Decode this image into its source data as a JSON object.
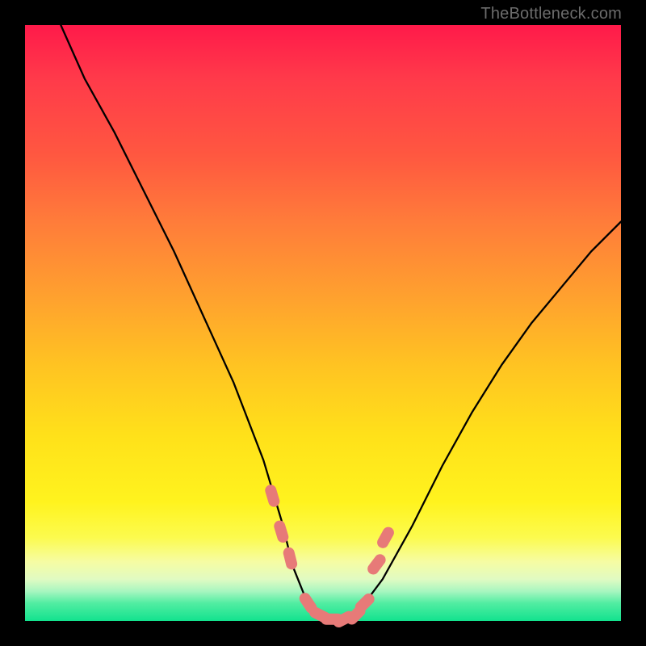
{
  "attribution": "TheBottleneck.com",
  "colors": {
    "frame": "#000000",
    "curve": "#000000",
    "lobes": "#e77a78",
    "attribution_text": "#6c6c6c"
  },
  "gradient_stops": [
    {
      "pct": 0,
      "color": "#ff1a4a"
    },
    {
      "pct": 9,
      "color": "#ff3a4a"
    },
    {
      "pct": 22,
      "color": "#ff5840"
    },
    {
      "pct": 33,
      "color": "#ff7c3a"
    },
    {
      "pct": 46,
      "color": "#ffa22e"
    },
    {
      "pct": 57,
      "color": "#ffc322"
    },
    {
      "pct": 69,
      "color": "#ffe11a"
    },
    {
      "pct": 80,
      "color": "#fff31e"
    },
    {
      "pct": 86,
      "color": "#fcfb4e"
    },
    {
      "pct": 90,
      "color": "#f6fca2"
    },
    {
      "pct": 93,
      "color": "#e0fbc2"
    },
    {
      "pct": 95,
      "color": "#a8f6c0"
    },
    {
      "pct": 97,
      "color": "#52eda2"
    },
    {
      "pct": 100,
      "color": "#12e28e"
    }
  ],
  "chart_data": {
    "type": "line",
    "title": "",
    "xlabel": "",
    "ylabel": "",
    "xlim": [
      0,
      100
    ],
    "ylim": [
      0,
      100
    ],
    "grid": false,
    "legend": false,
    "x": [
      6,
      10,
      15,
      20,
      25,
      30,
      35,
      40,
      43,
      45,
      47,
      49,
      51,
      53,
      55,
      57,
      60,
      65,
      70,
      75,
      80,
      85,
      90,
      95,
      100
    ],
    "series": [
      {
        "name": "bottleneck-curve",
        "values": [
          100,
          91,
          82,
          72,
          62,
          51,
          40,
          27,
          17,
          9,
          4,
          1,
          0,
          0,
          1,
          3,
          7,
          16,
          26,
          35,
          43,
          50,
          56,
          62,
          67
        ]
      }
    ],
    "markers": {
      "name": "highlight-points",
      "x": [
        41.5,
        43.0,
        44.5,
        47.5,
        49.5,
        51.5,
        53.5,
        55.5,
        57.0,
        59.0,
        60.5
      ],
      "y": [
        21.0,
        15.0,
        10.5,
        3.0,
        1.0,
        0.3,
        0.3,
        1.0,
        3.0,
        9.5,
        14.0
      ],
      "style": "pink-lobes"
    }
  }
}
